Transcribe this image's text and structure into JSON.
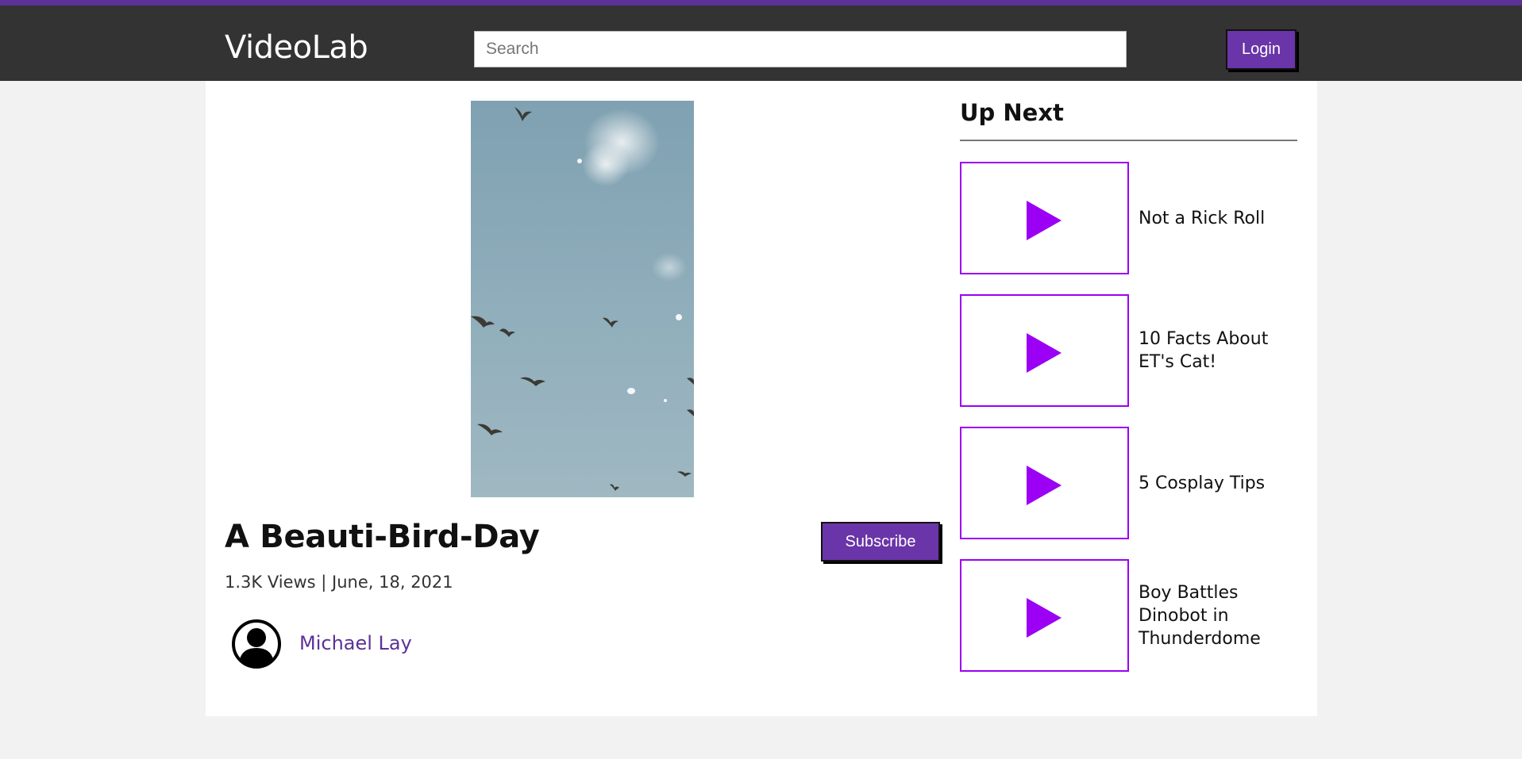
{
  "header": {
    "logo": "VideoLab",
    "search_placeholder": "Search",
    "login_label": "Login"
  },
  "video": {
    "title": "A Beauti-Bird-Day",
    "meta": "1.3K Views | June, 18, 2021",
    "subscribe_label": "Subscribe",
    "author": "Michael Lay"
  },
  "up_next": {
    "heading": "Up Next",
    "items": [
      {
        "label": "Not a Rick Roll"
      },
      {
        "label": "10 Facts About ET's Cat!"
      },
      {
        "label": "5 Cosplay Tips"
      },
      {
        "label": "Boy Battles Dinobot in Thunderdome"
      }
    ]
  },
  "colors": {
    "brand": "#6a35a8",
    "header_bg": "#333333",
    "play_icon": "#9b00f5",
    "page_bg": "#f2f2f2"
  },
  "icons": [
    "play-icon",
    "user-avatar-icon"
  ]
}
